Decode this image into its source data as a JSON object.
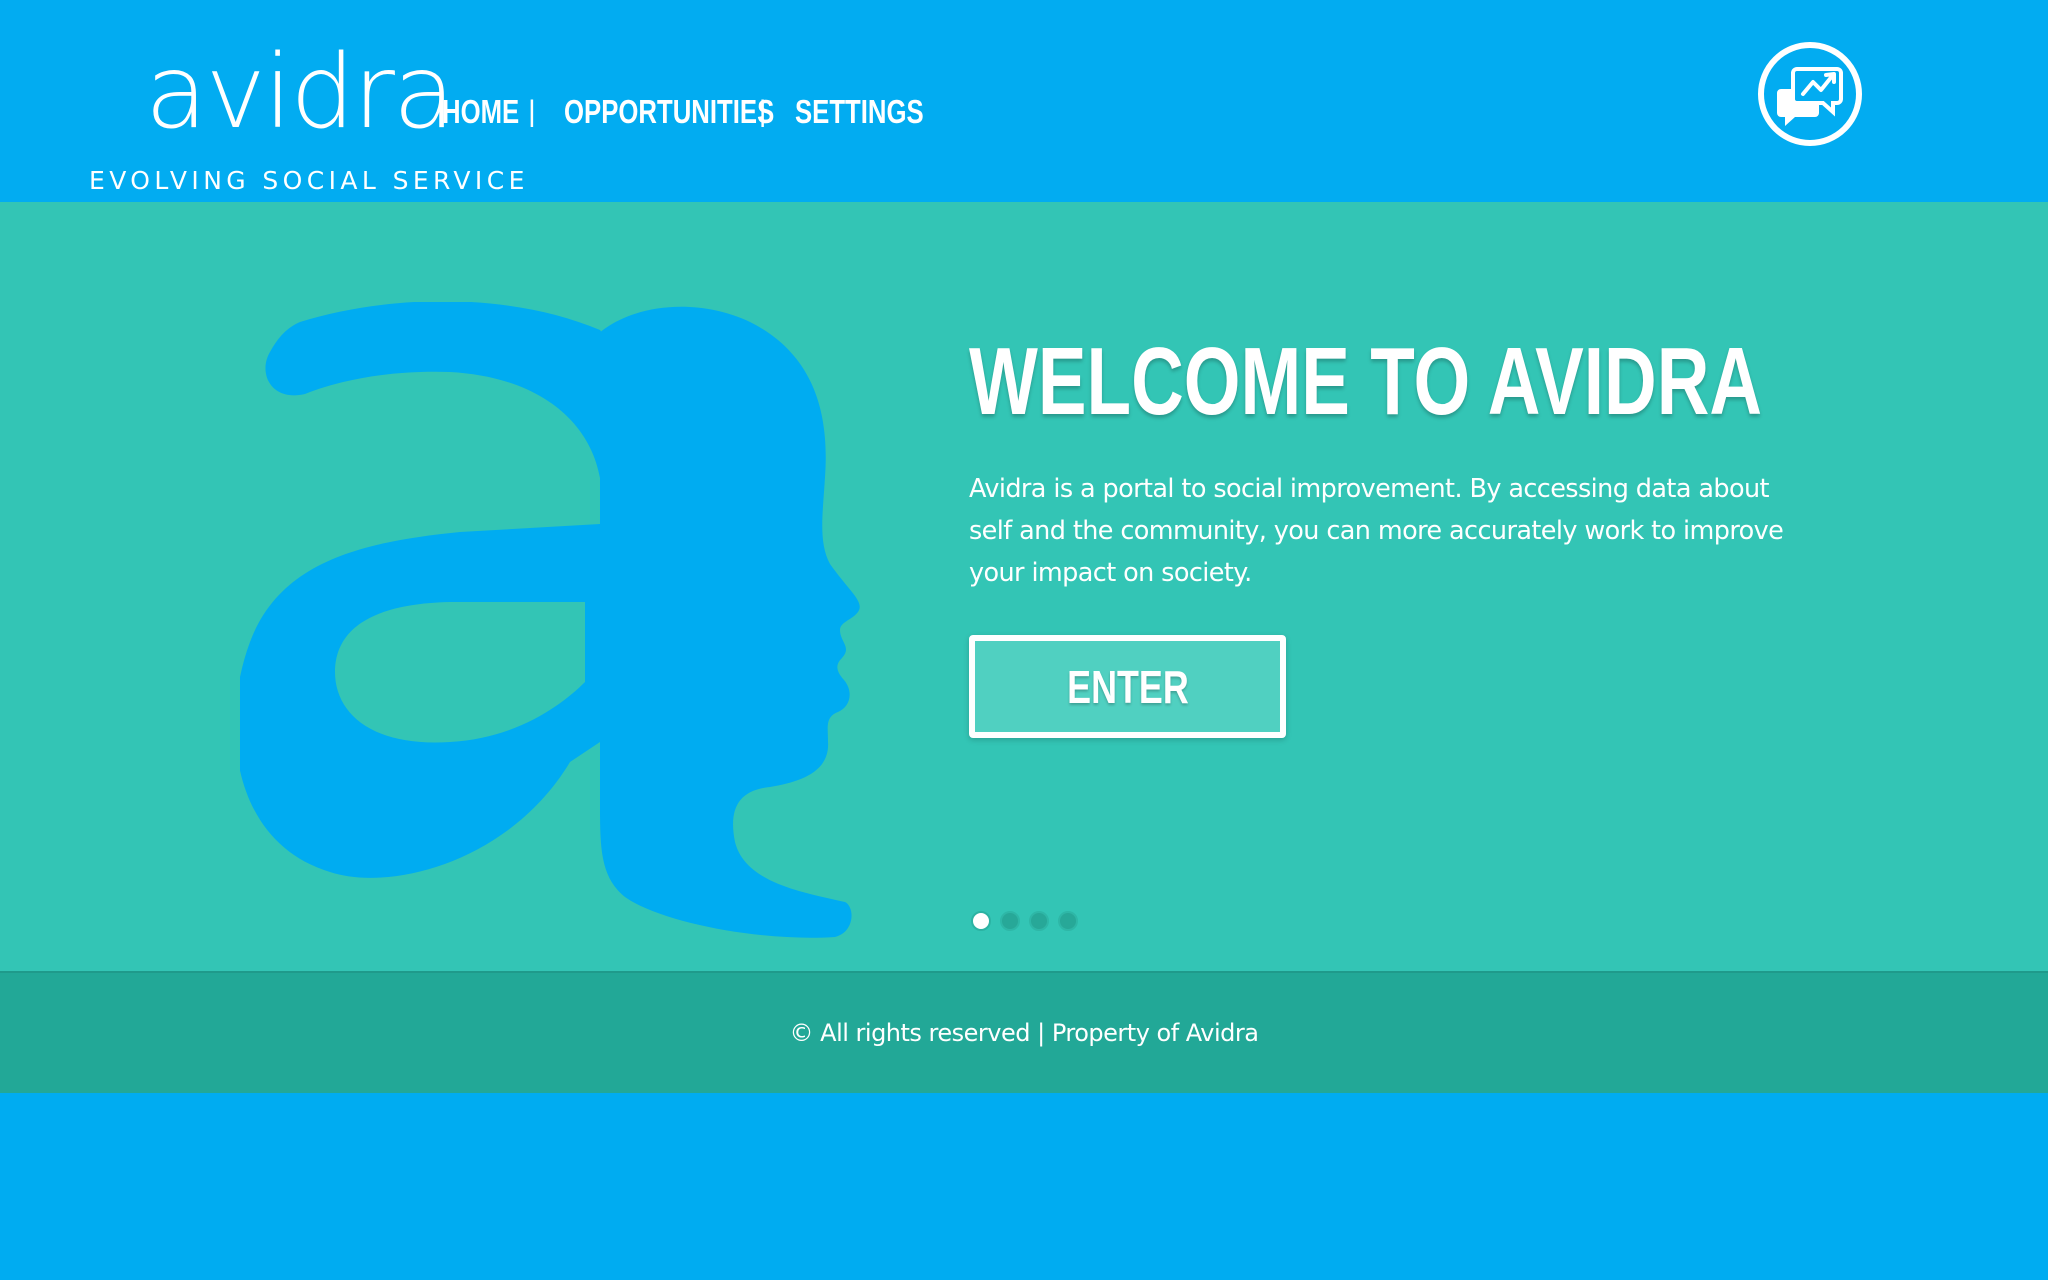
{
  "brand": {
    "name": "avidra",
    "tagline": "EVOLVING SOCIAL SERVICE"
  },
  "nav": {
    "items": [
      {
        "label": "HOME"
      },
      {
        "label": "OPPORTUNITIES"
      },
      {
        "label": "SETTINGS"
      }
    ],
    "separator": "|"
  },
  "header_actions": {
    "chat_icon": "chat-bubbles-graph-icon"
  },
  "hero": {
    "title": "WELCOME TO AVIDRA",
    "description": "Avidra is a portal to social improvement. By accessing data about self and the community, you can more accurately work to improve your impact on society.",
    "cta_label": "ENTER",
    "illustration": "letter-a-face-profile-icon",
    "slides": {
      "count": 4,
      "active_index": 0
    }
  },
  "footer": {
    "text": "© All rights reserved | Property of Avidra"
  },
  "colors": {
    "header_bg": "#02acf1",
    "hero_bg": "#33c5b5",
    "footer_bg": "#22a897",
    "accent_blue": "#00acf1",
    "button_bg": "#50d0c1",
    "text": "#ffffff"
  }
}
